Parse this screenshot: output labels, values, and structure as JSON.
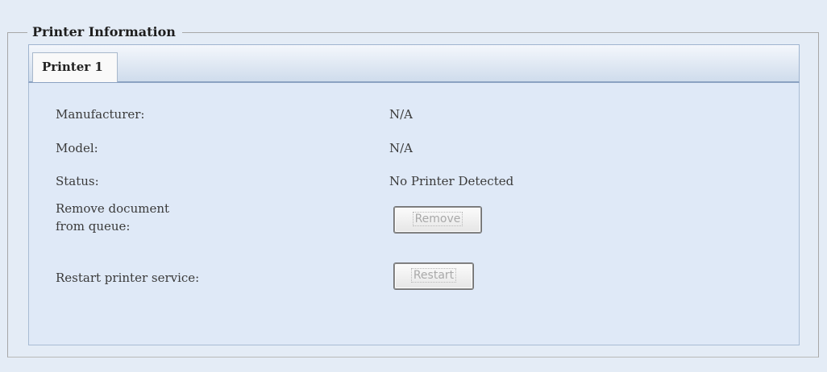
{
  "fieldset": {
    "legend": "Printer Information"
  },
  "tabs": [
    {
      "label": "Printer 1"
    }
  ],
  "info": {
    "manufacturer_label": "Manufacturer:",
    "manufacturer_value": "N/A",
    "model_label": "Model:",
    "model_value": "N/A",
    "status_label": "Status:",
    "status_value": "No Printer Detected",
    "remove_label_line1": "Remove document",
    "remove_label_line2": "from queue:",
    "restart_label": "Restart printer service:"
  },
  "buttons": {
    "remove_label": "Remove",
    "restart_label": "Restart"
  },
  "colors": {
    "page_background": "#e4ecf6",
    "panel_background": "#dfe9f7",
    "disabled_text": "#a9a9a9"
  }
}
